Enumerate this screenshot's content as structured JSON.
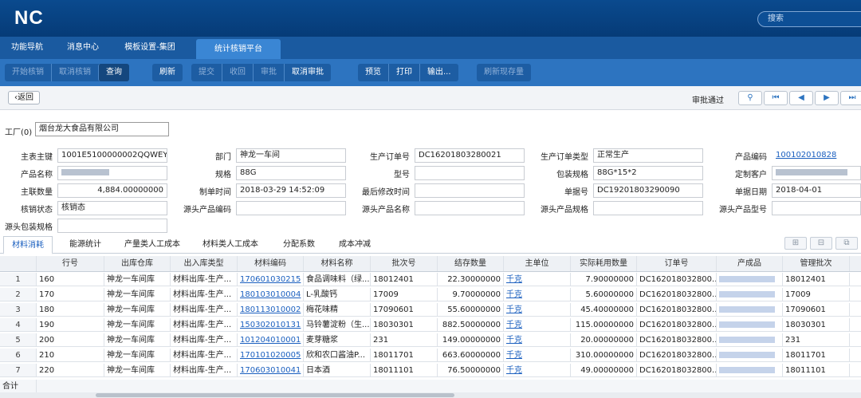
{
  "app": {
    "logo": "NC",
    "search_placeholder": "搜索"
  },
  "nav": {
    "tabs": [
      "功能导航",
      "消息中心",
      "模板设置-集团",
      "统计核销平台"
    ]
  },
  "toolbar": {
    "start_verify": "开始核销",
    "cancel_verify": "取消核销",
    "query": "查询",
    "refresh": "刷新",
    "submit": "提交",
    "recall": "收回",
    "approve": "审批",
    "cancel_approve": "取消审批",
    "preview": "预览",
    "print": "打印",
    "output": "输出...",
    "refresh_stock": "刷新现存量"
  },
  "status": {
    "back": "返回",
    "approval": "审批通过"
  },
  "factory": {
    "label": "工厂(0)",
    "value": "烟台龙大食品有限公司"
  },
  "form": {
    "main_key_label": "主表主键",
    "main_key": "1001E5100000002QQWEY",
    "product_name_label": "产品名称",
    "main_qty_label": "主联数量",
    "main_qty": "4,884.00000000",
    "verify_status_label": "核销状态",
    "verify_status": "核销态",
    "src_pack_label": "源头包装规格",
    "dept_label": "部门",
    "dept": "神龙一车间",
    "spec_label": "规格",
    "spec": "88G",
    "make_time_label": "制单时间",
    "make_time": "2018-03-29 14:52:09",
    "src_code_label": "源头产品编码",
    "order_no_label": "生产订单号",
    "order_no": "DC16201803280021",
    "model_label": "型号",
    "modify_time_label": "最后修改时间",
    "src_name_label": "源头产品名称",
    "order_type_label": "生产订单类型",
    "order_type": "正常生产",
    "pack_spec_label": "包装规格",
    "pack_spec": "88G*15*2",
    "doc_no_label": "单据号",
    "doc_no": "DC19201803290090",
    "src_spec_label": "源头产品规格",
    "product_code_label": "产品编码",
    "product_code": "100102010828",
    "custom_client_label": "定制客户",
    "doc_date_label": "单据日期",
    "doc_date": "2018-04-01",
    "src_model_label": "源头产品型号"
  },
  "subtabs": [
    "材料消耗",
    "能源统计",
    "产量类人工成本",
    "材料类人工成本",
    "分配系数",
    "成本冲减"
  ],
  "grid": {
    "columns": [
      "行号",
      "出库仓库",
      "出入库类型",
      "材料编码",
      "材料名称",
      "批次号",
      "结存数量",
      "主单位",
      "实际耗用数量",
      "订单号",
      "产成品",
      "管理批次"
    ],
    "rows": [
      [
        "1",
        "160",
        "神龙一车间库",
        "材料出库-生产...",
        "170601030215",
        "食品调味料（绿...",
        "18012401",
        "22.30000000",
        "千克",
        "7.90000000",
        "DC162018032800...",
        "18012401"
      ],
      [
        "2",
        "170",
        "神龙一车间库",
        "材料出库-生产...",
        "180103010004",
        "L-乳酸钙",
        "17009",
        "9.70000000",
        "千克",
        "5.60000000",
        "DC162018032800...",
        "17009"
      ],
      [
        "3",
        "180",
        "神龙一车间库",
        "材料出库-生产...",
        "180113010002",
        "梅花味精",
        "17090601",
        "55.60000000",
        "千克",
        "45.40000000",
        "DC162018032800...",
        "17090601"
      ],
      [
        "4",
        "190",
        "神龙一车间库",
        "材料出库-生产...",
        "150302010131",
        "马铃薯淀粉（生...",
        "18030301",
        "882.50000000",
        "千克",
        "115.00000000",
        "DC162018032800...",
        "18030301"
      ],
      [
        "5",
        "200",
        "神龙一车间库",
        "材料出库-生产...",
        "101204010001",
        "麦芽糖浆",
        "231",
        "149.00000000",
        "千克",
        "20.00000000",
        "DC162018032800...",
        "231"
      ],
      [
        "6",
        "210",
        "神龙一车间库",
        "材料出库-生产...",
        "170101020005",
        "欣和农口酱油P...",
        "18011701",
        "663.60000000",
        "千克",
        "310.00000000",
        "DC162018032800...",
        "18011701"
      ],
      [
        "7",
        "220",
        "神龙一车间库",
        "材料出库-生产...",
        "170603010041",
        "日本酒",
        "18011101",
        "76.50000000",
        "千克",
        "49.00000000",
        "DC162018032800...",
        "18011101"
      ]
    ],
    "total_label": "合计"
  }
}
